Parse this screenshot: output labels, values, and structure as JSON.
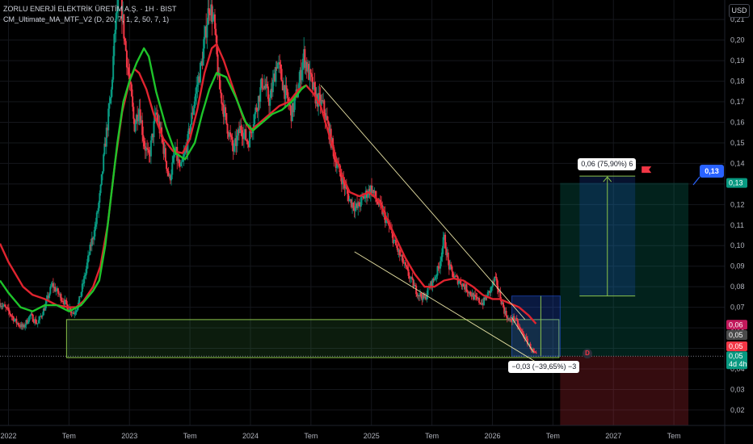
{
  "legend": {
    "title": "ZORLU ENERJİ ELEKTRİK ÜRETİM A.Ş. · 1H · BIST",
    "indicator": "CM_Ultimate_MA_MTF_V2 (D, 20, 7, 1, 2, 50, 7, 1)"
  },
  "currency": "USD",
  "chart_data": {
    "type": "candlestick",
    "y_axis": {
      "ticks": [
        "0,21",
        "0,20",
        "0,19",
        "0,18",
        "0,17",
        "0,16",
        "0,15",
        "0,14",
        "0,13",
        "0,12",
        "0,11",
        "0,10",
        "0,09",
        "0,08",
        "0,07",
        "0,06",
        "0,05",
        "0,04",
        "0,03",
        "0,02"
      ],
      "tick_values": [
        0.21,
        0.2,
        0.19,
        0.18,
        0.17,
        0.16,
        0.15,
        0.14,
        0.13,
        0.12,
        0.11,
        0.1,
        0.09,
        0.08,
        0.07,
        0.06,
        0.05,
        0.04,
        0.03,
        0.02
      ],
      "ylim": [
        0.0125,
        0.2195
      ]
    },
    "x_axis": {
      "ticks": [
        {
          "label": "2022",
          "t": 2022.0
        },
        {
          "label": "Tem",
          "t": 2022.5
        },
        {
          "label": "2023",
          "t": 2023.0
        },
        {
          "label": "Tem",
          "t": 2023.5
        },
        {
          "label": "2024",
          "t": 2024.0
        },
        {
          "label": "Tem",
          "t": 2024.5
        },
        {
          "label": "2025",
          "t": 2025.0
        },
        {
          "label": "Tem",
          "t": 2025.5
        },
        {
          "label": "2026",
          "t": 2026.0
        },
        {
          "label": "Tem",
          "t": 2026.5
        },
        {
          "label": "2027",
          "t": 2027.0
        },
        {
          "label": "Tem",
          "t": 2027.5
        }
      ]
    },
    "price_path": [
      [
        2021.93,
        0.072
      ],
      [
        2022.0,
        0.068
      ],
      [
        2022.06,
        0.063
      ],
      [
        2022.12,
        0.06
      ],
      [
        2022.18,
        0.066
      ],
      [
        2022.24,
        0.062
      ],
      [
        2022.3,
        0.07
      ],
      [
        2022.36,
        0.081
      ],
      [
        2022.42,
        0.076
      ],
      [
        2022.48,
        0.071
      ],
      [
        2022.54,
        0.067
      ],
      [
        2022.58,
        0.072
      ],
      [
        2022.63,
        0.085
      ],
      [
        2022.68,
        0.1
      ],
      [
        2022.72,
        0.11
      ],
      [
        2022.76,
        0.126
      ],
      [
        2022.8,
        0.15
      ],
      [
        2022.85,
        0.175
      ],
      [
        2022.88,
        0.205
      ],
      [
        2022.92,
        0.225
      ],
      [
        2022.96,
        0.2
      ],
      [
        2023.0,
        0.18
      ],
      [
        2023.04,
        0.158
      ],
      [
        2023.08,
        0.168
      ],
      [
        2023.12,
        0.15
      ],
      [
        2023.16,
        0.142
      ],
      [
        2023.22,
        0.165
      ],
      [
        2023.28,
        0.148
      ],
      [
        2023.33,
        0.132
      ],
      [
        2023.38,
        0.146
      ],
      [
        2023.42,
        0.136
      ],
      [
        2023.48,
        0.15
      ],
      [
        2023.54,
        0.172
      ],
      [
        2023.6,
        0.19
      ],
      [
        2023.66,
        0.218
      ],
      [
        2023.7,
        0.208
      ],
      [
        2023.74,
        0.178
      ],
      [
        2023.8,
        0.16
      ],
      [
        2023.86,
        0.146
      ],
      [
        2023.92,
        0.158
      ],
      [
        2023.98,
        0.15
      ],
      [
        2024.04,
        0.165
      ],
      [
        2024.1,
        0.18
      ],
      [
        2024.16,
        0.17
      ],
      [
        2024.22,
        0.19
      ],
      [
        2024.28,
        0.176
      ],
      [
        2024.34,
        0.164
      ],
      [
        2024.4,
        0.178
      ],
      [
        2024.44,
        0.193
      ],
      [
        2024.48,
        0.184
      ],
      [
        2024.54,
        0.172
      ],
      [
        2024.6,
        0.168
      ],
      [
        2024.64,
        0.158
      ],
      [
        2024.7,
        0.142
      ],
      [
        2024.76,
        0.132
      ],
      [
        2024.82,
        0.122
      ],
      [
        2024.88,
        0.118
      ],
      [
        2024.94,
        0.124
      ],
      [
        2025.0,
        0.128
      ],
      [
        2025.04,
        0.122
      ],
      [
        2025.08,
        0.118
      ],
      [
        2025.14,
        0.11
      ],
      [
        2025.2,
        0.1
      ],
      [
        2025.26,
        0.092
      ],
      [
        2025.32,
        0.084
      ],
      [
        2025.38,
        0.077
      ],
      [
        2025.44,
        0.074
      ],
      [
        2025.48,
        0.08
      ],
      [
        2025.52,
        0.084
      ],
      [
        2025.56,
        0.09
      ],
      [
        2025.6,
        0.104
      ],
      [
        2025.64,
        0.09
      ],
      [
        2025.68,
        0.085
      ],
      [
        2025.74,
        0.082
      ],
      [
        2025.8,
        0.078
      ],
      [
        2025.86,
        0.074
      ],
      [
        2025.92,
        0.072
      ],
      [
        2025.98,
        0.078
      ],
      [
        2026.02,
        0.084
      ],
      [
        2026.06,
        0.076
      ],
      [
        2026.1,
        0.068
      ],
      [
        2026.14,
        0.063
      ],
      [
        2026.18,
        0.065
      ],
      [
        2026.22,
        0.06
      ],
      [
        2026.26,
        0.056
      ],
      [
        2026.3,
        0.052
      ],
      [
        2026.34,
        0.048
      ],
      [
        2026.37,
        0.046
      ]
    ],
    "ma_green": [
      [
        2021.93,
        0.083
      ],
      [
        2022.0,
        0.077
      ],
      [
        2022.1,
        0.07
      ],
      [
        2022.2,
        0.068
      ],
      [
        2022.3,
        0.071
      ],
      [
        2022.4,
        0.071
      ],
      [
        2022.5,
        0.068
      ],
      [
        2022.6,
        0.071
      ],
      [
        2022.7,
        0.078
      ],
      [
        2022.75,
        0.083
      ],
      [
        2022.8,
        0.1
      ],
      [
        2022.85,
        0.125
      ],
      [
        2022.9,
        0.15
      ],
      [
        2022.95,
        0.17
      ],
      [
        2023.0,
        0.18
      ],
      [
        2023.06,
        0.189
      ],
      [
        2023.12,
        0.196
      ],
      [
        2023.16,
        0.192
      ],
      [
        2023.22,
        0.175
      ],
      [
        2023.3,
        0.158
      ],
      [
        2023.38,
        0.145
      ],
      [
        2023.46,
        0.142
      ],
      [
        2023.54,
        0.15
      ],
      [
        2023.6,
        0.164
      ],
      [
        2023.66,
        0.176
      ],
      [
        2023.72,
        0.184
      ],
      [
        2023.8,
        0.182
      ],
      [
        2023.88,
        0.172
      ],
      [
        2023.96,
        0.16
      ],
      [
        2024.02,
        0.156
      ],
      [
        2024.1,
        0.16
      ],
      [
        2024.18,
        0.164
      ],
      [
        2024.26,
        0.166
      ],
      [
        2024.34,
        0.17
      ],
      [
        2024.42,
        0.176
      ],
      [
        2024.46,
        0.178
      ]
    ],
    "ma_red": [
      [
        2021.93,
        0.101
      ],
      [
        2022.0,
        0.092
      ],
      [
        2022.06,
        0.086
      ],
      [
        2022.12,
        0.08
      ],
      [
        2022.2,
        0.076
      ],
      [
        2022.3,
        0.074
      ],
      [
        2022.4,
        0.071
      ],
      [
        2022.5,
        0.07
      ],
      [
        2022.56,
        0.07
      ],
      [
        2022.62,
        0.073
      ],
      [
        2022.7,
        0.08
      ],
      [
        2022.76,
        0.09
      ],
      [
        2022.82,
        0.11
      ],
      [
        2022.88,
        0.14
      ],
      [
        2022.94,
        0.165
      ],
      [
        2023.0,
        0.18
      ],
      [
        2023.04,
        0.186
      ],
      [
        2023.08,
        0.184
      ],
      [
        2023.14,
        0.176
      ],
      [
        2023.2,
        0.164
      ],
      [
        2023.28,
        0.152
      ],
      [
        2023.36,
        0.146
      ],
      [
        2023.44,
        0.145
      ],
      [
        2023.5,
        0.152
      ],
      [
        2023.56,
        0.166
      ],
      [
        2023.62,
        0.184
      ],
      [
        2023.68,
        0.196
      ],
      [
        2023.72,
        0.198
      ],
      [
        2023.78,
        0.19
      ],
      [
        2023.86,
        0.176
      ],
      [
        2023.94,
        0.162
      ],
      [
        2024.0,
        0.156
      ],
      [
        2024.08,
        0.16
      ],
      [
        2024.16,
        0.164
      ],
      [
        2024.24,
        0.168
      ],
      [
        2024.32,
        0.17
      ],
      [
        2024.4,
        0.176
      ],
      [
        2024.46,
        0.178
      ],
      [
        2024.52,
        0.174
      ],
      [
        2024.58,
        0.168
      ],
      [
        2024.64,
        0.156
      ],
      [
        2024.7,
        0.144
      ],
      [
        2024.76,
        0.134
      ],
      [
        2024.82,
        0.126
      ],
      [
        2024.9,
        0.124
      ],
      [
        2024.98,
        0.126
      ],
      [
        2025.06,
        0.122
      ],
      [
        2025.12,
        0.114
      ],
      [
        2025.2,
        0.104
      ],
      [
        2025.28,
        0.094
      ],
      [
        2025.36,
        0.086
      ],
      [
        2025.44,
        0.08
      ],
      [
        2025.52,
        0.08
      ],
      [
        2025.6,
        0.083
      ],
      [
        2025.68,
        0.084
      ],
      [
        2025.76,
        0.083
      ],
      [
        2025.84,
        0.08
      ],
      [
        2025.92,
        0.076
      ],
      [
        2026.0,
        0.074
      ],
      [
        2026.06,
        0.074
      ],
      [
        2026.14,
        0.072
      ],
      [
        2026.22,
        0.07
      ],
      [
        2026.3,
        0.066
      ],
      [
        2026.36,
        0.062
      ]
    ],
    "trend_lines": [
      {
        "from": [
          2024.58,
          0.178
        ],
        "to": [
          2026.27,
          0.064
        ],
        "color": "#e6e0a3"
      },
      {
        "from": [
          2024.86,
          0.097
        ],
        "to": [
          2026.37,
          0.043
        ],
        "color": "#e6e0a3"
      },
      {
        "from": [
          2026.16,
          0.065
        ],
        "to": [
          2026.34,
          0.048
        ],
        "color": "#e6e0a3"
      }
    ],
    "support_zone": {
      "t1": 2022.48,
      "t2": 2026.55,
      "y1": 0.0455,
      "y2": 0.064,
      "fill": "rgba(76,175,80,0.16)",
      "stroke": "#8bc34a"
    },
    "position_small": {
      "t1": 2026.16,
      "t2": 2026.56,
      "entry": 0.0462,
      "target": 0.0755,
      "t_mid": 2026.4
    },
    "position_large": {
      "t1": 2026.56,
      "t2": 2027.62,
      "entry": 0.0462,
      "target": 0.1305,
      "stop": 0.0125
    },
    "measure": {
      "t1": 2026.72,
      "t2": 2027.18,
      "y1": 0.0755,
      "y2": 0.1338
    },
    "hline": 0.0462,
    "annotations": {
      "up_label": "0,06 (75,90%) 6",
      "down_label": "−0,03 (−39,65%) −3",
      "bubble": "0,13",
      "d_marker": "D"
    },
    "price_tags": [
      {
        "value": 0.0615,
        "text": "0,06",
        "bg": "#c2185b"
      },
      {
        "value": 0.0565,
        "text": "0,05",
        "bg": "#4a4a4a"
      },
      {
        "value": 0.051,
        "text": "0,05",
        "bg": "#f23645"
      },
      {
        "value": 0.1305,
        "text": "0,13",
        "bg": "#089981"
      },
      {
        "value": 0.0462,
        "text": "0,05",
        "bg": "#089981",
        "sub": "4d 4h"
      }
    ]
  }
}
